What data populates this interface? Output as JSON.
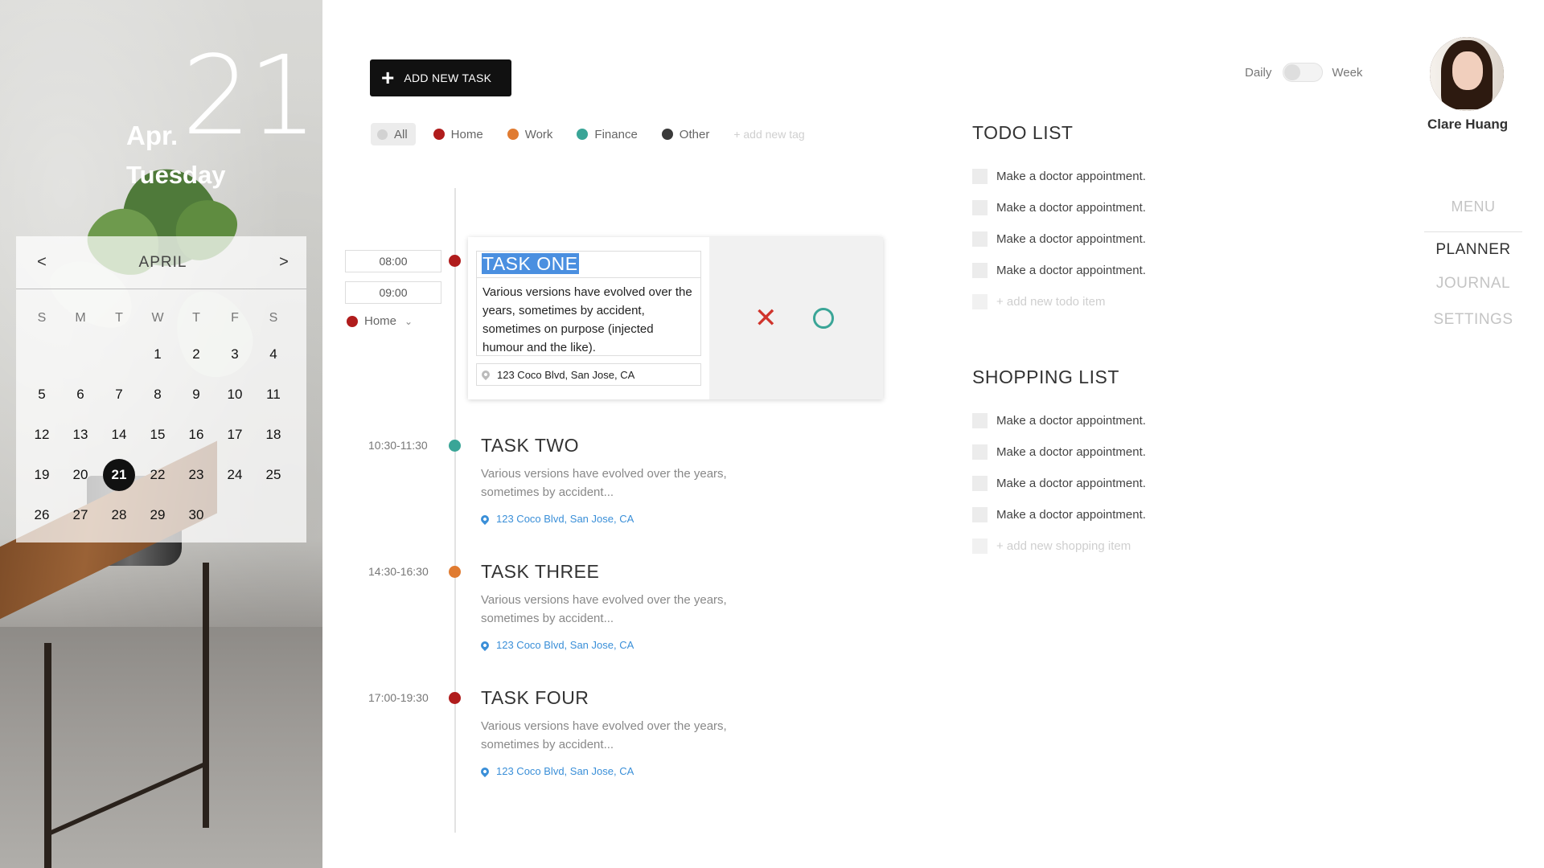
{
  "colors": {
    "home": "#b01c1c",
    "work": "#e07b31",
    "finance": "#3aa597",
    "other": "#3a3a3a",
    "link": "#3a8fd8",
    "cancel": "#d0342c",
    "confirm": "#3aa597"
  },
  "date": {
    "day": "21",
    "month": "Apr.",
    "weekday": "Tuesday"
  },
  "calendar": {
    "month": "APRIL",
    "prev": "<",
    "next": ">",
    "weekdays": [
      "S",
      "M",
      "T",
      "W",
      "T",
      "F",
      "S"
    ],
    "selected_day": "21",
    "days": [
      "",
      "",
      "",
      "1",
      "2",
      "3",
      "4",
      "5",
      "6",
      "7",
      "8",
      "9",
      "10",
      "11",
      "12",
      "13",
      "14",
      "15",
      "16",
      "17",
      "18",
      "19",
      "20",
      "21",
      "22",
      "23",
      "24",
      "25",
      "26",
      "27",
      "28",
      "29",
      "30",
      "",
      ""
    ]
  },
  "toolbar": {
    "add_task_label": "ADD NEW TASK",
    "add_icon": "plus-icon"
  },
  "tags": {
    "all": "All",
    "home": "Home",
    "work": "Work",
    "finance": "Finance",
    "other": "Other",
    "add": "+ add new tag"
  },
  "editing_task": {
    "start": "08:00",
    "end": "09:00",
    "tag": "Home",
    "title": "TASK ONE",
    "description": "Various versions have evolved over the years, sometimes by accident, sometimes on purpose (injected humour and the like).",
    "location": "123 Coco Blvd, San Jose, CA",
    "cancel_icon": "close-icon",
    "confirm_icon": "circle-check-icon"
  },
  "tasks": [
    {
      "time": "10:30-11:30",
      "title": "TASK TWO",
      "description": "Various versions have evolved over the years, sometimes by accident...",
      "location": "123 Coco Blvd, San Jose, CA",
      "color": "#3aa597"
    },
    {
      "time": "14:30-16:30",
      "title": "TASK THREE",
      "description": "Various versions have evolved over the years, sometimes by accident...",
      "location": "123 Coco Blvd, San Jose, CA",
      "color": "#e07b31"
    },
    {
      "time": "17:00-19:30",
      "title": "TASK FOUR",
      "description": "Various versions have evolved over the years, sometimes by accident...",
      "location": "123 Coco Blvd, San Jose, CA",
      "color": "#b01c1c"
    }
  ],
  "todo": {
    "title": "TODO LIST",
    "items": [
      "Make a doctor appointment.",
      "Make a doctor appointment.",
      "Make a doctor appointment.",
      "Make a doctor appointment."
    ],
    "add": "+ add new todo item"
  },
  "shopping": {
    "title": "SHOPPING LIST",
    "items": [
      "Make a doctor appointment.",
      "Make a doctor appointment.",
      "Make a doctor appointment.",
      "Make a doctor appointment."
    ],
    "add": "+ add new shopping item"
  },
  "view_toggle": {
    "left": "Daily",
    "right": "Week",
    "state": "Daily"
  },
  "user": {
    "name": "Clare Huang"
  },
  "menu": {
    "heading": "MENU",
    "items": [
      {
        "label": "PLANNER",
        "active": true
      },
      {
        "label": "JOURNAL",
        "active": false
      },
      {
        "label": "SETTINGS",
        "active": false
      }
    ]
  }
}
